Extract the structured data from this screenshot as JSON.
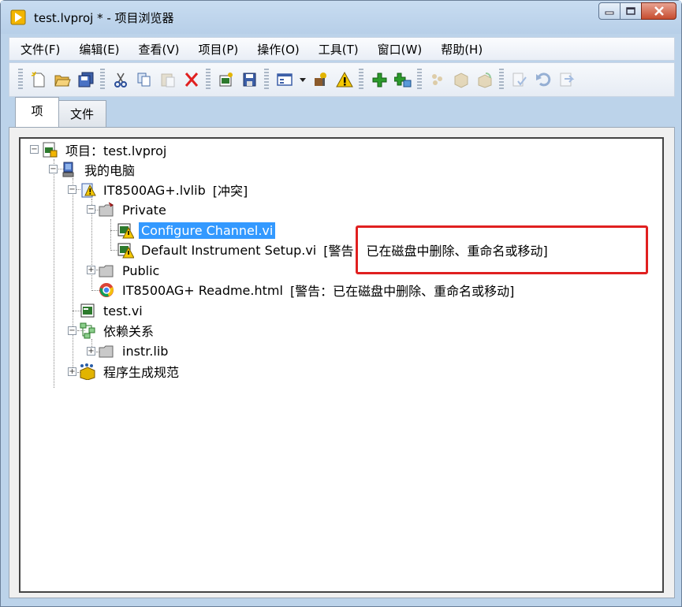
{
  "window": {
    "title": "test.lvproj * - 项目浏览器",
    "buttons": [
      "minimize",
      "maximize",
      "close"
    ]
  },
  "menu": [
    "文件(F)",
    "编辑(E)",
    "查看(V)",
    "项目(P)",
    "操作(O)",
    "工具(T)",
    "窗口(W)",
    "帮助(H)"
  ],
  "toolbar": {
    "icons": [
      "new-file-icon",
      "open-icon",
      "save-all-icon",
      "cut-icon",
      "copy-icon",
      "paste-icon",
      "delete-icon",
      "project-properties-icon",
      "save-icon",
      "view-icon",
      "dropdown-icon",
      "resolve-conflicts-icon",
      "warning-icon",
      "add-item-icon",
      "add-folder-icon",
      "build-icon",
      "package-icon",
      "deploy-icon",
      "check-icon",
      "undo-icon",
      "refresh-icon"
    ]
  },
  "tabs": {
    "items": "项",
    "files": "文件"
  },
  "tree": {
    "project": "项目：test.lvproj",
    "my_computer": "我的电脑",
    "lvlib": "IT8500AG+.lvlib",
    "lvlib_conflict": "[冲突]",
    "private": "Private",
    "configure_channel": "Configure Channel.vi",
    "default_setup": "Default Instrument Setup.vi",
    "default_setup_warning": "[警告：已在磁盘中删除、重命名或移动]",
    "public": "Public",
    "readme": "IT8500AG+ Readme.html",
    "readme_warning": "[警告：已在磁盘中删除、重命名或移动]",
    "test_vi": "test.vi",
    "dependencies": "依赖关系",
    "instr_lib": "instr.lib",
    "build_specs": "程序生成规范"
  },
  "colors": {
    "selection": "#3399ff",
    "highlight_box": "#e02020",
    "window_frame": "#bcd3ea"
  }
}
